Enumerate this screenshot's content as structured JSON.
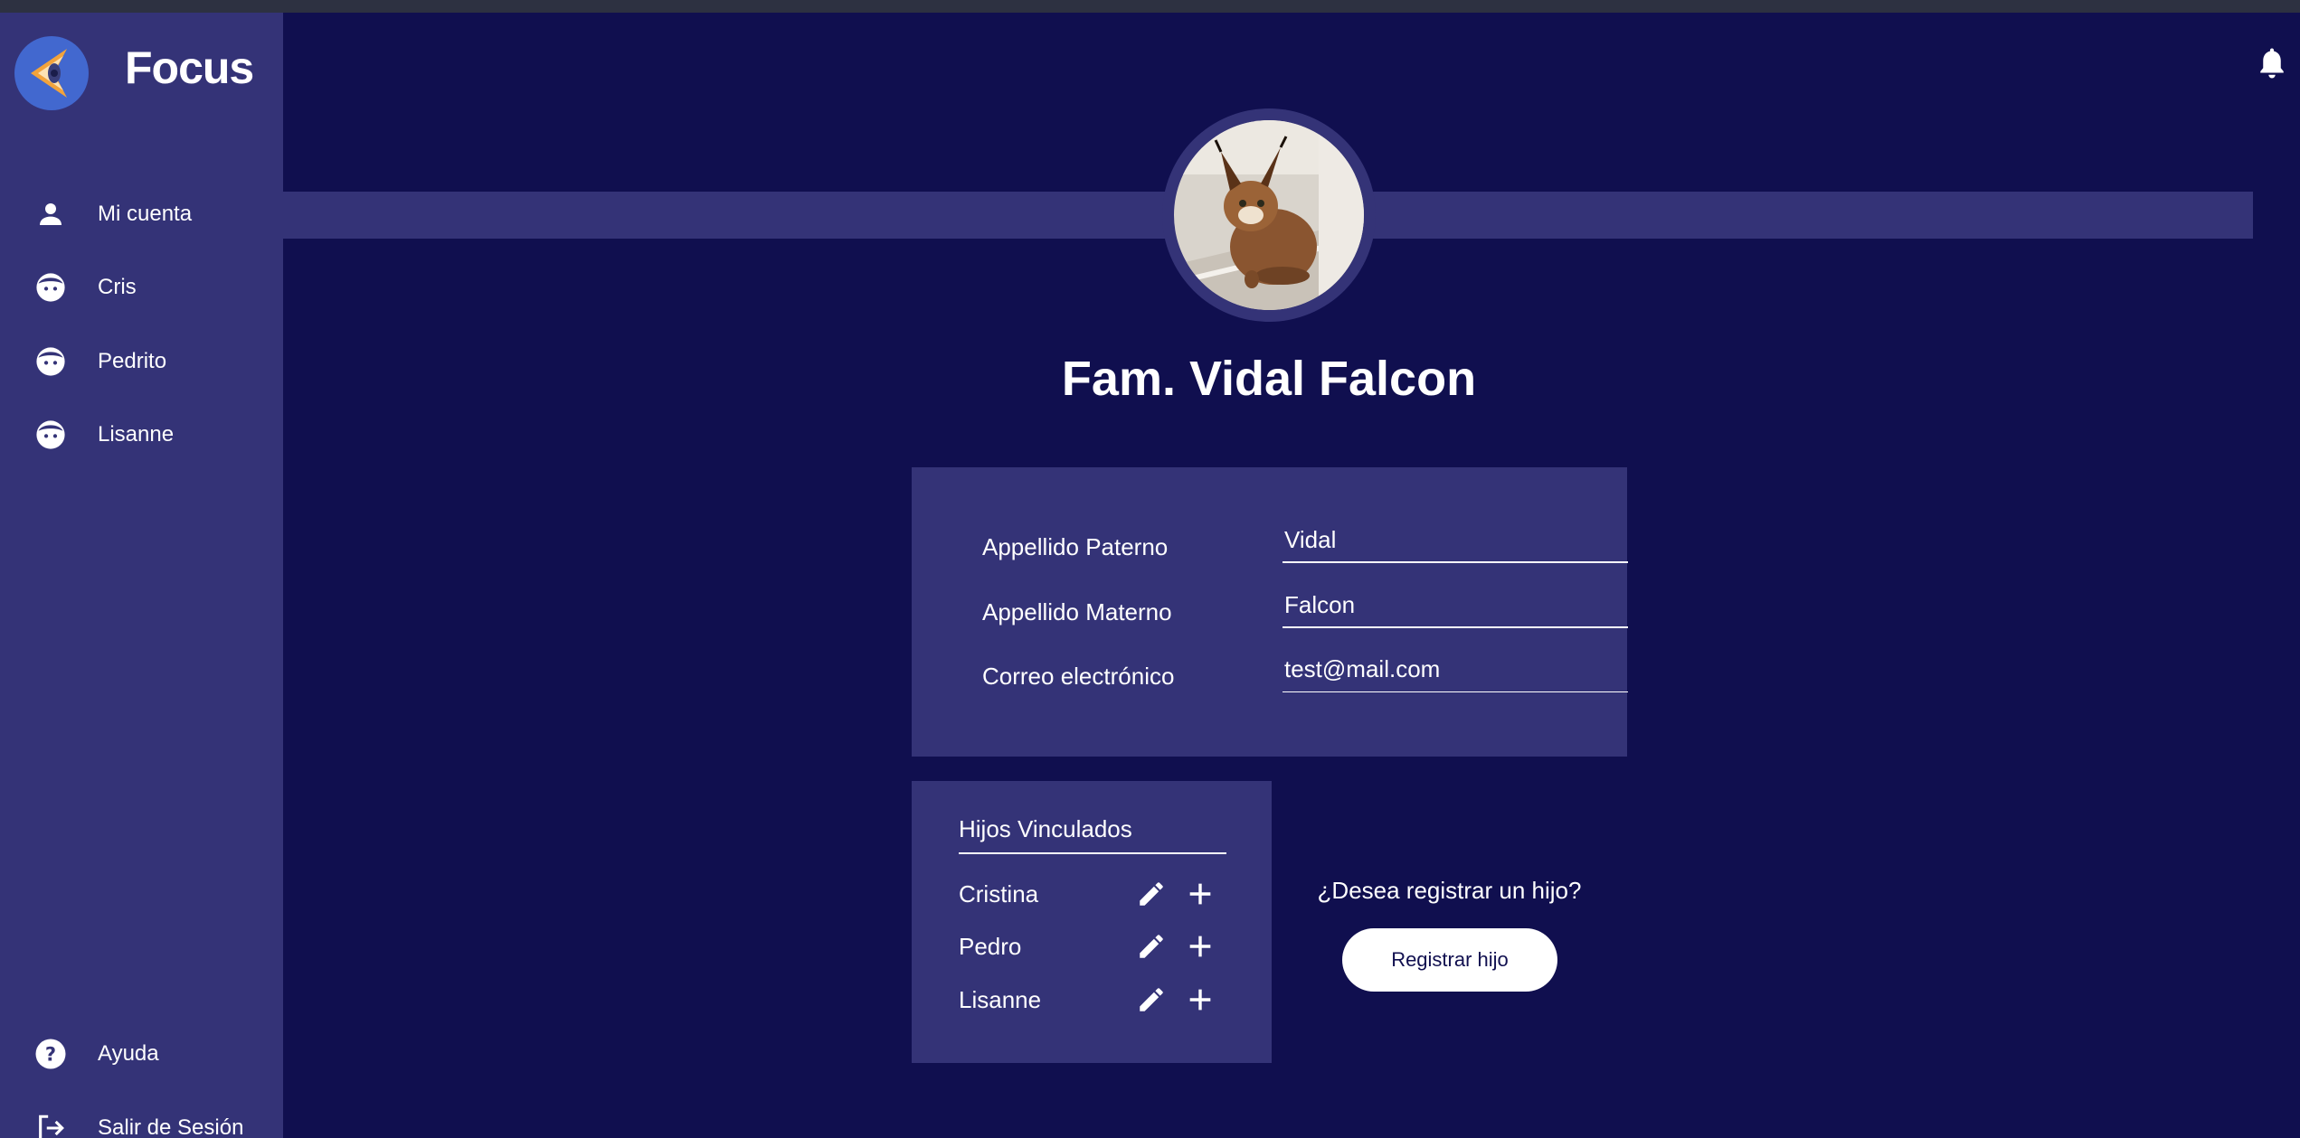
{
  "app": {
    "name": "Focus",
    "logo_icon": "focus-eye-logo"
  },
  "sidebar": {
    "items": [
      {
        "label": "Mi cuenta",
        "icon": "person-icon"
      },
      {
        "label": "Cris",
        "icon": "child-face-icon"
      },
      {
        "label": "Pedrito",
        "icon": "child-face-icon"
      },
      {
        "label": "Lisanne",
        "icon": "child-face-icon"
      }
    ],
    "bottom_items": [
      {
        "label": "Ayuda",
        "icon": "help-icon"
      },
      {
        "label": "Salir de Sesión",
        "icon": "logout-icon"
      }
    ]
  },
  "header": {
    "notification_icon": "bell-icon"
  },
  "profile": {
    "title": "Fam. Vidal Falcon",
    "avatar": "caracal-photo"
  },
  "form": {
    "fields": [
      {
        "label": "Appellido Paterno",
        "value": "Vidal"
      },
      {
        "label": "Appellido Materno",
        "value": "Falcon"
      },
      {
        "label": "Correo electrónico",
        "value": "test@mail.com"
      }
    ]
  },
  "children": {
    "title": "Hijos Vinculados",
    "items": [
      {
        "name": "Cristina"
      },
      {
        "name": "Pedro"
      },
      {
        "name": "Lisanne"
      }
    ]
  },
  "register": {
    "question": "¿Desea registrar un hijo?",
    "button_label": "Registrar hijo"
  },
  "colors": {
    "background": "#100f4f",
    "panel": "#343377",
    "logo": "#4268cf",
    "text": "#ffffff"
  }
}
